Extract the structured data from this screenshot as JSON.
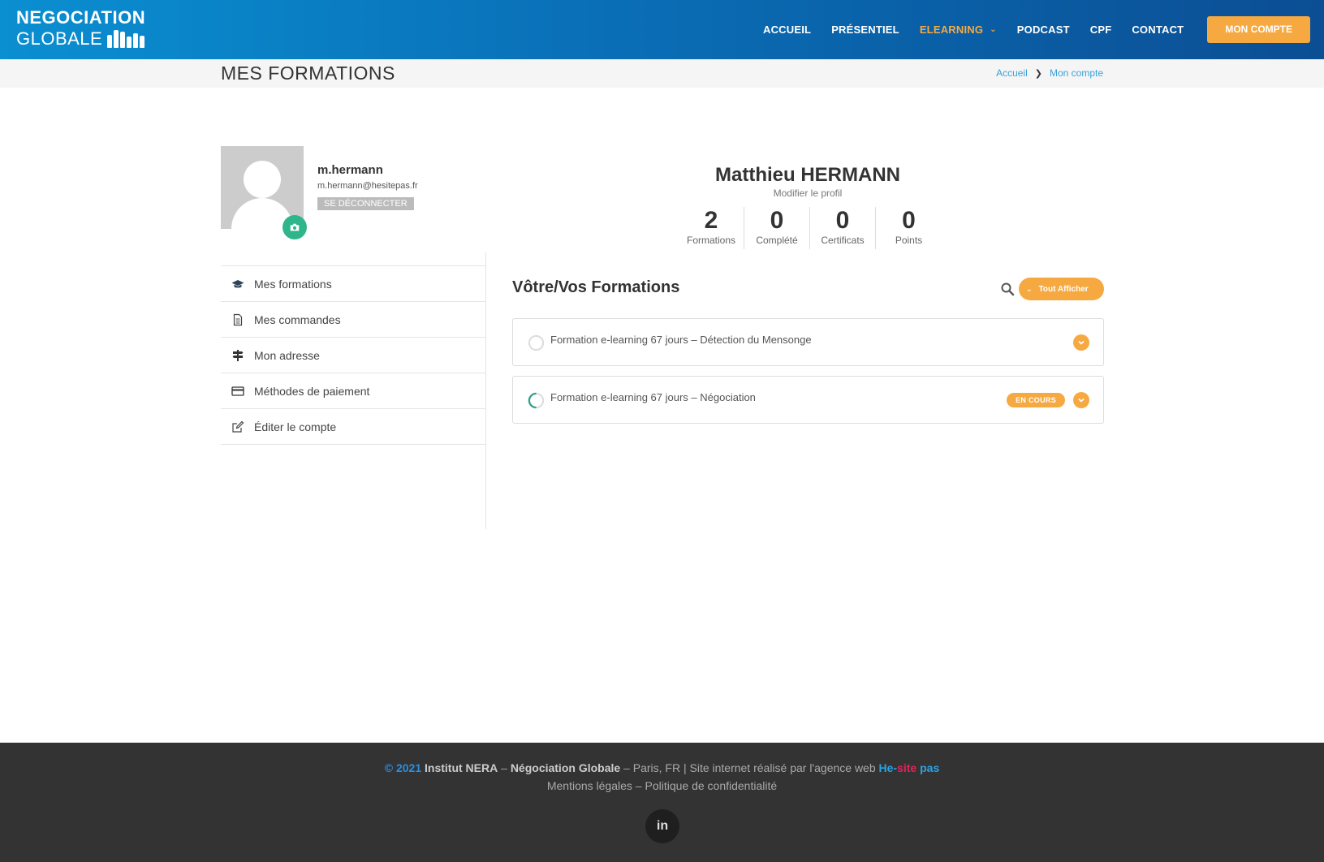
{
  "header": {
    "logo_line1": "NEGOCIATION",
    "logo_line2": "GLOBALE",
    "nav": [
      {
        "label": "ACCUEIL"
      },
      {
        "label": "PRÉSENTIEL"
      },
      {
        "label": "ELEARNING"
      },
      {
        "label": "PODCAST"
      },
      {
        "label": "CPF"
      },
      {
        "label": "CONTACT"
      }
    ],
    "account_button": "MON COMPTE",
    "active_color": "#f7a941"
  },
  "titlebar": {
    "title": "MES FORMATIONS",
    "breadcrumb": [
      "Accueil",
      "Mon compte"
    ]
  },
  "profile": {
    "username": "m.hermann",
    "email": "m.hermann@hesitepas.fr",
    "logout": "SE DÉCONNECTER",
    "full_name": "Matthieu HERMANN",
    "edit_profile": "Modifier le profil",
    "stats": [
      {
        "value": "2",
        "label": "Formations"
      },
      {
        "value": "0",
        "label": "Complété"
      },
      {
        "value": "0",
        "label": "Certificats"
      },
      {
        "value": "0",
        "label": "Points"
      }
    ]
  },
  "sidebar": {
    "items": [
      {
        "label": "Mes formations",
        "icon": "graduation-cap-icon"
      },
      {
        "label": "Mes commandes",
        "icon": "document-icon"
      },
      {
        "label": "Mon adresse",
        "icon": "signpost-icon"
      },
      {
        "label": "Méthodes de paiement",
        "icon": "credit-card-icon"
      },
      {
        "label": "Éditer le compte",
        "icon": "edit-icon"
      }
    ]
  },
  "formations": {
    "title": "Vôtre/Vos Formations",
    "show_all": "Tout Afficher",
    "courses": [
      {
        "title": "Formation e-learning 67 jours – Détection du Mensonge",
        "badge": ""
      },
      {
        "title": "Formation e-learning 67 jours – Négociation",
        "badge": "EN COURS"
      }
    ]
  },
  "footer": {
    "copyright": "© 2021",
    "org": "Institut NERA",
    "dash1": " – ",
    "brand": "Négociation Globale",
    "location": " – Paris, FR | Site internet réalisé par l'agence web ",
    "hs_part1": "He-",
    "hs_part2": "site",
    "hs_part3": " pas",
    "legal": "Mentions légales",
    "legal_sep": " – ",
    "privacy": "Politique de confidentialité",
    "social": "in"
  }
}
